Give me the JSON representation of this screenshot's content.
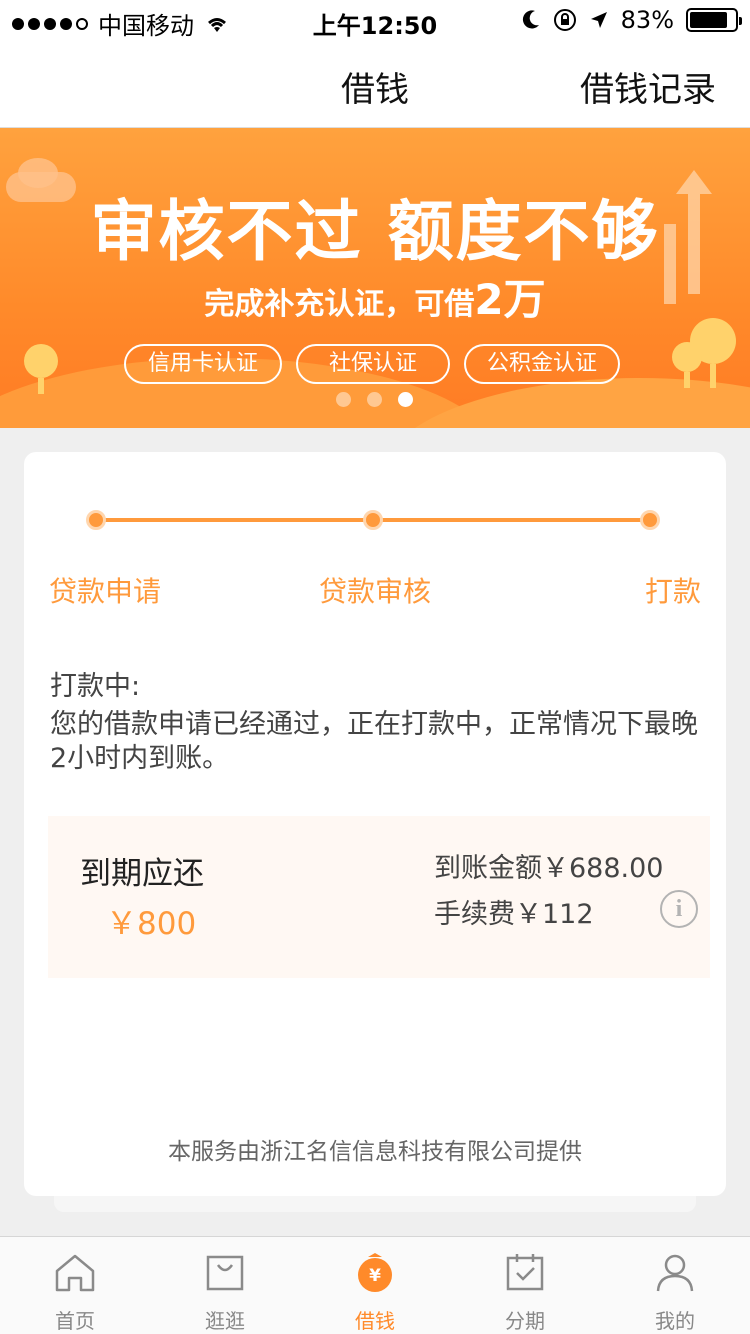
{
  "status_bar": {
    "carrier": "中国移动",
    "time": "上午12:50",
    "battery_percent": "83%",
    "battery_level": 0.83
  },
  "nav": {
    "title": "借钱",
    "right_action": "借钱记录"
  },
  "banner": {
    "title": "审核不过 额度不够",
    "subtitle_prefix": "完成补充认证，可借",
    "subtitle_highlight": "2万",
    "tags": [
      "信用卡认证",
      "社保认证",
      "公积金认证"
    ],
    "pager_count": 3,
    "pager_active": 3
  },
  "steps": {
    "labels": [
      "贷款申请",
      "贷款审核",
      "打款"
    ]
  },
  "status": {
    "heading": "打款中:",
    "text": "您的借款申请已经通过，正在打款中，正常情况下最晚2小时内到账。"
  },
  "repayment": {
    "due_label": "到期应还",
    "due_value": "￥800",
    "received_line": "到账金额￥688.00",
    "fee_line": "手续费￥112"
  },
  "footer": {
    "provider": "本服务由浙江名信信息科技有限公司提供"
  },
  "tabbar": {
    "items": [
      {
        "label": "首页",
        "icon": "home-icon"
      },
      {
        "label": "逛逛",
        "icon": "shopping-bag-icon"
      },
      {
        "label": "借钱",
        "icon": "yen-coin-icon"
      },
      {
        "label": "分期",
        "icon": "calendar-check-icon"
      },
      {
        "label": "我的",
        "icon": "user-icon"
      }
    ],
    "active_index": 2
  },
  "colors": {
    "accent": "#ff9a3c",
    "banner_top": "#ffa23e",
    "banner_bottom": "#ff7b24",
    "tab_active": "#ff8a2a"
  }
}
